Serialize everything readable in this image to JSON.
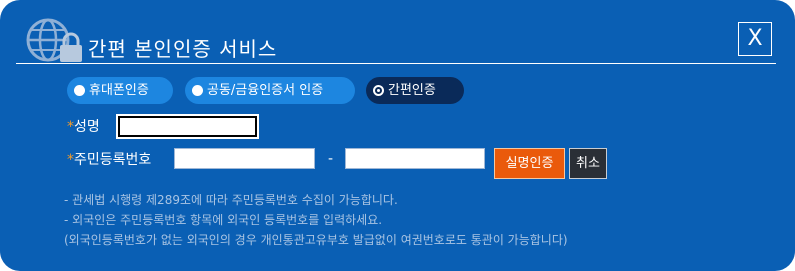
{
  "dialog": {
    "title": "간편 본인인증 서비스",
    "close_label": "X"
  },
  "tabs": [
    {
      "label": "휴대폰인증",
      "active": false
    },
    {
      "label": "공동/금융인증서 인증",
      "active": false
    },
    {
      "label": "간편인증",
      "active": true
    }
  ],
  "form": {
    "required_mark": "*",
    "name_label": "성명",
    "name_value": "",
    "rrn_label": "주민등록번호",
    "rrn_front_value": "",
    "rrn_separator": "-",
    "rrn_back_value": "",
    "verify_button": "실명인증",
    "cancel_button": "취소"
  },
  "notes": [
    "- 관세법 시행령 제289조에 따라 주민등록번호 수집이 가능합니다.",
    "- 외국인은 주민등록번호 항목에 외국인 등록번호를 입력하세요.",
    "(외국인등록번호가 없는 외국인의 경우 개인통관고유부호 발급없이 여권번호로도 통관이 가능합니다)"
  ],
  "colors": {
    "dialog_bg": "#0a5fb4",
    "tab_bg": "#1d86e0",
    "tab_active_bg": "#0a2a59",
    "accent_orange": "#ea5a0b",
    "required_star": "#f59c2a"
  }
}
